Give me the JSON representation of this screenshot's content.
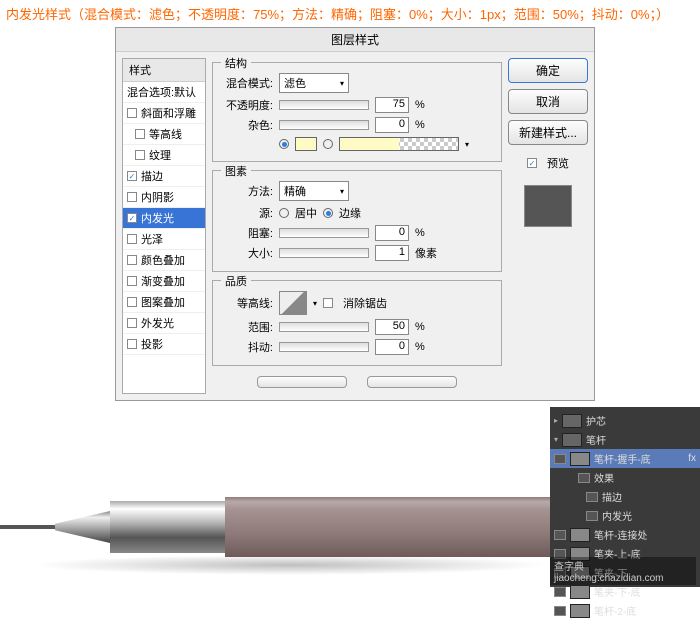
{
  "caption": "内发光样式（混合模式：滤色；不透明度：75%；方法：精确；阻塞：0%；大小：1px；范围：50%；抖动：0%；）",
  "dialog": {
    "title": "图层样式",
    "sidebar_header": "样式",
    "blend_options": "混合选项:默认",
    "effects": {
      "bevel": "斜面和浮雕",
      "contour": "等高线",
      "texture": "纹理",
      "stroke": "描边",
      "inner_shadow": "内阴影",
      "inner_glow": "内发光",
      "satin": "光泽",
      "color_overlay": "颜色叠加",
      "gradient_overlay": "渐变叠加",
      "pattern_overlay": "图案叠加",
      "outer_glow": "外发光",
      "drop_shadow": "投影"
    },
    "structure": {
      "title": "结构",
      "blend_mode_label": "混合模式:",
      "blend_mode_value": "滤色",
      "opacity_label": "不透明度:",
      "opacity_value": "75",
      "noise_label": "杂色:",
      "noise_value": "0",
      "percent": "%"
    },
    "elements": {
      "title": "图素",
      "method_label": "方法:",
      "method_value": "精确",
      "source_label": "源:",
      "source_center": "居中",
      "source_edge": "边缘",
      "choke_label": "阻塞:",
      "choke_value": "0",
      "size_label": "大小:",
      "size_value": "1",
      "px": "像素",
      "percent": "%"
    },
    "quality": {
      "title": "品质",
      "contour_label": "等高线:",
      "antialias": "消除锯齿",
      "range_label": "范围:",
      "range_value": "50",
      "jitter_label": "抖动:",
      "jitter_value": "0",
      "percent": "%"
    },
    "buttons": {
      "ok": "确定",
      "cancel": "取消",
      "new_style": "新建样式...",
      "preview": "预览"
    }
  },
  "layers": {
    "huxin": "护芯",
    "bigan": "笔杆",
    "bigan_woshou": "笔杆-握手-底",
    "fx": "fx",
    "effects": "效果",
    "stroke": "描边",
    "inner_glow": "内发光",
    "bigan_lianjie": "笔杆-连接处",
    "bijia_shang": "笔夹-上-底",
    "bijia_xia": "笔夹-下",
    "bijia_xia2": "笔夹-下-底",
    "bigan2": "笔杆-2-底"
  },
  "watermark": "查字典 jiaocheng.chazidian.com"
}
